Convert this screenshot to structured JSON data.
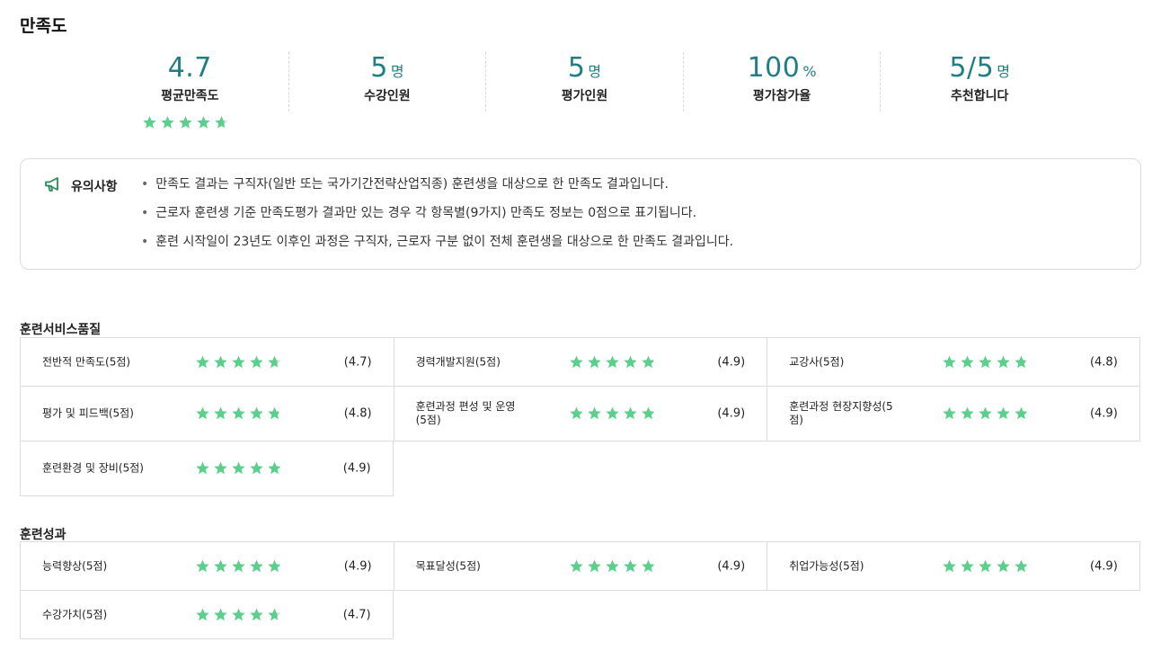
{
  "page": {
    "title": "만족도"
  },
  "summary": {
    "avg": {
      "value": "4.7",
      "label": "평균만족도",
      "rating": 4.7
    },
    "enrolled": {
      "value": "5",
      "unit": "명",
      "label": "수강인원"
    },
    "evaluated": {
      "value": "5",
      "unit": "명",
      "label": "평가인원"
    },
    "participation": {
      "value": "100",
      "unit": "%",
      "label": "평가참가율"
    },
    "recommend": {
      "value": "5/5",
      "unit": "명",
      "label": "추천합니다"
    }
  },
  "notice": {
    "title": "유의사항",
    "items": [
      "만족도 결과는 구직자(일반 또는 국가기간전략산업직종) 훈련생을 대상으로 한 만족도 결과입니다.",
      "근로자 훈련생 기준 만족도평가 결과만 있는 경우 각 항목별(9가지) 만족도 정보는 0점으로 표기됩니다.",
      "훈련 시작일이 23년도 이후인 과정은 구직자, 근로자 구분 없이 전체 훈련생을 대상으로 한 만족도 결과입니다."
    ]
  },
  "service_quality": {
    "title": "훈련서비스품질",
    "items": [
      {
        "label": "전반적 만족도(5점)",
        "rating": 4.7,
        "score": "(4.7)"
      },
      {
        "label": "경력개발지원(5점)",
        "rating": 4.9,
        "score": "(4.9)"
      },
      {
        "label": "교강사(5점)",
        "rating": 4.8,
        "score": "(4.8)"
      },
      {
        "label": "평가 및 피드백(5점)",
        "rating": 4.8,
        "score": "(4.8)"
      },
      {
        "label": "훈련과정 편성 및 운영(5점)",
        "rating": 4.9,
        "score": "(4.9)"
      },
      {
        "label": "훈련과정 현장지향성(5점)",
        "rating": 4.9,
        "score": "(4.9)"
      },
      {
        "label": "훈련환경 및 장비(5점)",
        "rating": 4.9,
        "score": "(4.9)"
      }
    ]
  },
  "outcomes": {
    "title": "훈련성과",
    "items": [
      {
        "label": "능력향상(5점)",
        "rating": 4.9,
        "score": "(4.9)"
      },
      {
        "label": "목표달성(5점)",
        "rating": 4.9,
        "score": "(4.9)"
      },
      {
        "label": "취업가능성(5점)",
        "rating": 4.9,
        "score": "(4.9)"
      },
      {
        "label": "수강가치(5점)",
        "rating": 4.7,
        "score": "(4.7)"
      }
    ]
  },
  "colors": {
    "star_filled": "#5ccf8c",
    "star_empty": "#dddddd",
    "accent": "#1f7f85",
    "notice_icon": "#2f8a5a"
  },
  "icons": {
    "star": "star-icon",
    "notice": "megaphone-icon"
  }
}
